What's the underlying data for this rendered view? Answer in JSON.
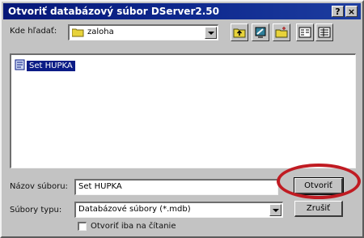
{
  "titlebar": {
    "title": "Otvoriť databázový súbor DServer2.50",
    "help_label": "?",
    "close_label": "×"
  },
  "look_in": {
    "label": "Kde hľadať:",
    "value": "zaloha",
    "icon": "folder-icon"
  },
  "toolbar": {
    "icons": [
      "up-folder-icon",
      "desktop-icon",
      "new-folder-icon",
      "list-view-icon",
      "details-view-icon"
    ]
  },
  "file_list": {
    "items": [
      {
        "name": "Set HUPKA",
        "icon": "database-file-icon",
        "selected": true
      }
    ]
  },
  "filename": {
    "label": "Názov súboru:",
    "value": "Set HUPKA"
  },
  "filetype": {
    "label": "Súbory typu:",
    "value": "Databázové súbory (*.mdb)"
  },
  "buttons": {
    "open_label": "Otvoriť",
    "cancel_label": "Zrušiť"
  },
  "readonly": {
    "label": "Otvoriť iba na čítanie",
    "checked": false
  },
  "colors": {
    "titlebar": "#0f2a8f",
    "dialog": "#c3c3c3",
    "selection": "#0b1c86",
    "annotation": "#c01b22"
  }
}
